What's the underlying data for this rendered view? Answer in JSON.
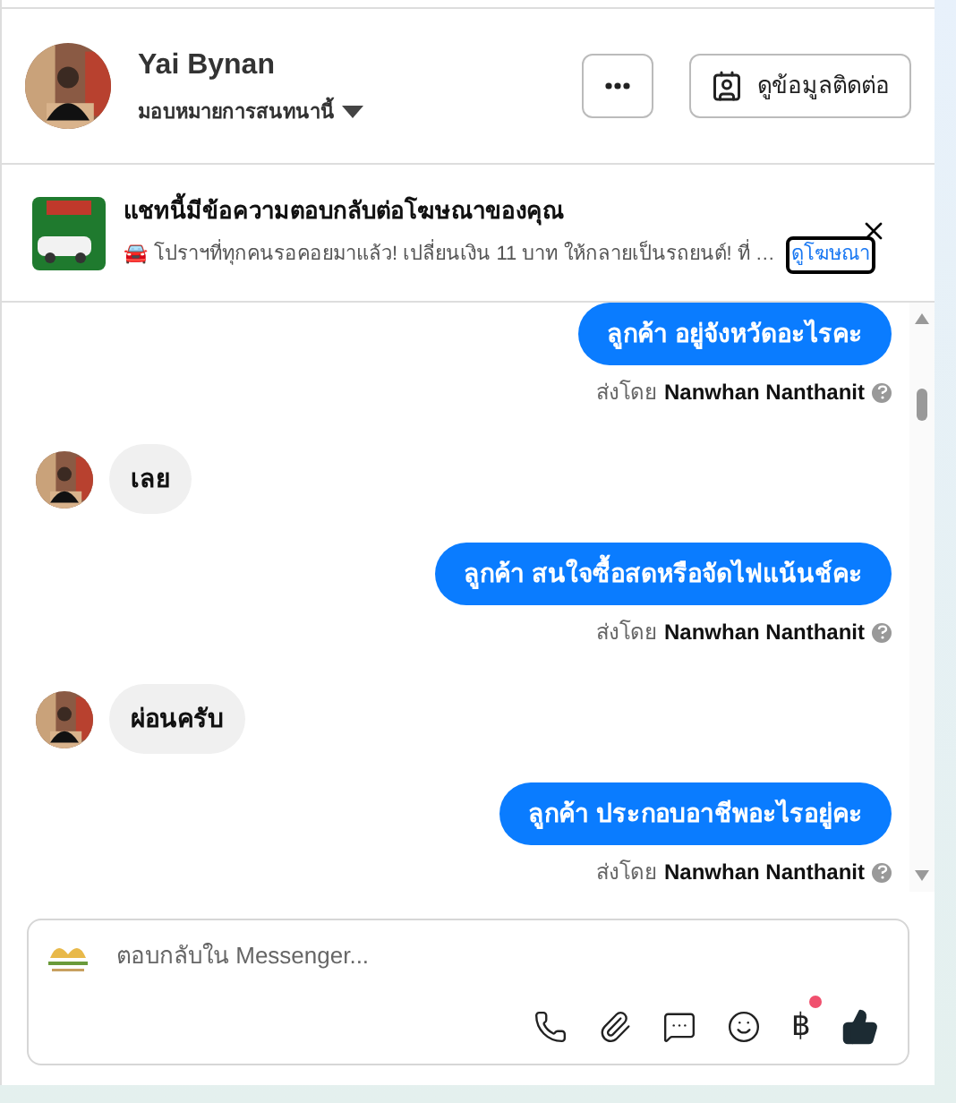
{
  "header": {
    "name": "Yai Bynan",
    "assign": "มอบหมายการสนทนานี้",
    "contact_button": "ดูข้อมูลติดต่อ"
  },
  "ad_banner": {
    "title": "แชทนี้มีข้อความตอบกลับต่อโฆษณาของคุณ",
    "text": "🚘 โปราฯที่ทุกคนรอคอยมาแล้ว! เปลี่ยนเงิน 11 บาท ให้กลายเป็นรถยนต์! ที่ …",
    "link": "ดูโฆษณา"
  },
  "messages": [
    {
      "kind": "sent",
      "text": "ลูกค้า อยู่จังหวัดอะไรคะ",
      "sent_by_label": "ส่งโดย",
      "sender": "Nanwhan Nanthanit"
    },
    {
      "kind": "received",
      "text": "เลย"
    },
    {
      "kind": "sent",
      "text": "ลูกค้า สนใจซื้อสดหรือจัดไฟแน้นช์คะ",
      "sent_by_label": "ส่งโดย",
      "sender": "Nanwhan Nanthanit"
    },
    {
      "kind": "received",
      "text": "ผ่อนครับ"
    },
    {
      "kind": "sent",
      "text": "ลูกค้า  ประกอบอาชีพอะไรอยู่คะ",
      "sent_by_label": "ส่งโดย",
      "sender": "Nanwhan Nanthanit"
    }
  ],
  "composer": {
    "placeholder": "ตอบกลับใน Messenger...",
    "currency_symbol": "฿",
    "currency_notification": true
  }
}
